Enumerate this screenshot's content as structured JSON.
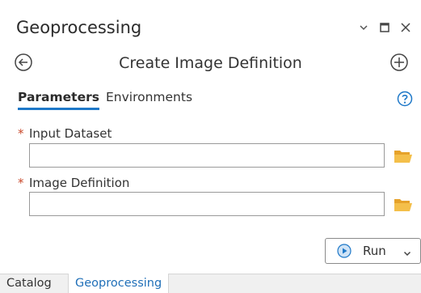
{
  "window": {
    "title": "Geoprocessing",
    "controls": [
      "chevron-down-icon",
      "maximize-icon",
      "close-icon"
    ]
  },
  "tool": {
    "title": "Create Image Definition",
    "back_icon": "back-circle-icon",
    "add_icon": "add-circle-icon"
  },
  "tabs": [
    {
      "label": "Parameters",
      "active": true
    },
    {
      "label": "Environments",
      "active": false
    }
  ],
  "help_icon": "help-icon",
  "parameters": [
    {
      "label": "Input Dataset",
      "required": true,
      "required_marker": "*",
      "value": ""
    },
    {
      "label": "Image Definition",
      "required": true,
      "required_marker": "*",
      "value": ""
    }
  ],
  "run": {
    "label": "Run"
  },
  "bottom_tabs": [
    {
      "label": "Catalog",
      "active": false
    },
    {
      "label": "Geoprocessing",
      "active": true
    }
  ],
  "colors": {
    "accent": "#1e78c8",
    "required": "#c8482a",
    "folder": "#f0b33a"
  }
}
